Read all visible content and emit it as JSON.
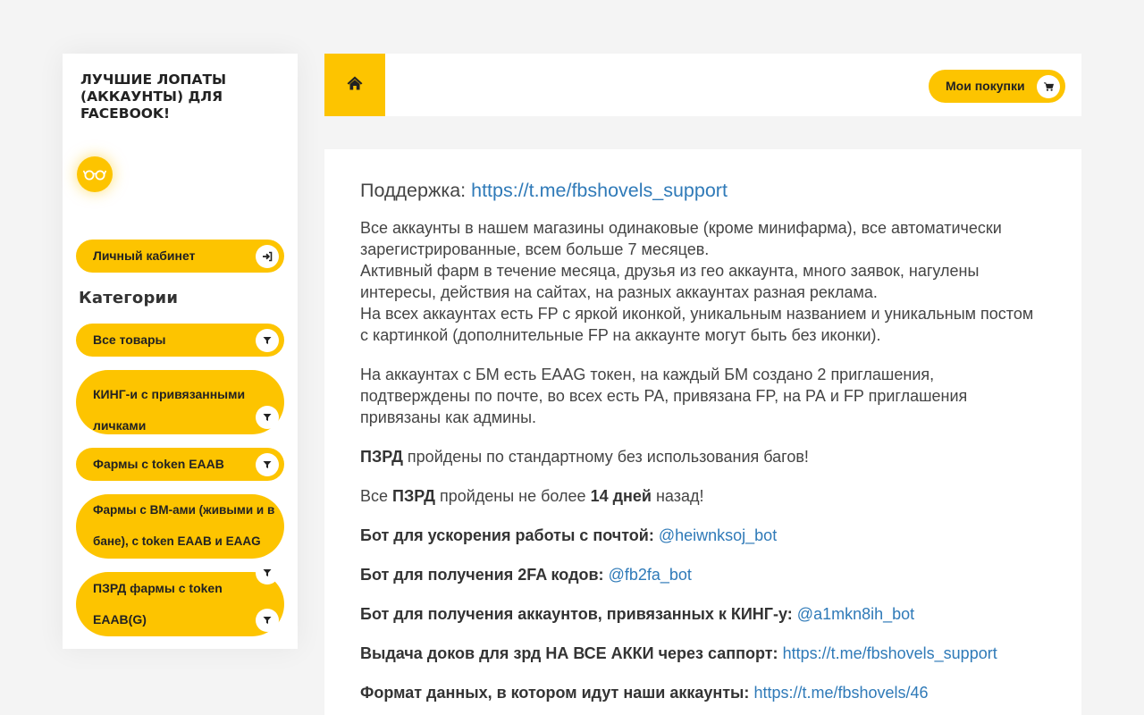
{
  "brand": {
    "line1": "ЛУЧШИЕ ЛОПАТЫ",
    "line2": "(АККАУНТЫ) ДЛЯ",
    "line3": "FACEBOOK!",
    "avatar_icon": "glasses-icon"
  },
  "sidebar": {
    "account_button": {
      "label": "Личный кабинет",
      "icon": "sign-in-icon"
    },
    "categories_title": "Категории",
    "categories": [
      {
        "label": "Все товары",
        "icon": "filter-icon"
      },
      {
        "label_line1": "КИНГ-и с привязанными",
        "label_line2": "личками",
        "icon": "filter-icon"
      },
      {
        "label": "Фармы с token EAAB",
        "icon": "filter-icon"
      },
      {
        "label_line1": "Фармы с BM-ами (живыми и в",
        "label_line2": "бане), с token EAAB и EAAG",
        "icon": "filter-icon"
      },
      {
        "label_line1": "ПЗРД фармы с token",
        "label_line2": "EAAB(G)",
        "icon": "filter-icon"
      }
    ]
  },
  "topbar": {
    "home_icon": "home-icon",
    "purchases_label": "Мои покупки",
    "purchases_icon": "cart-icon"
  },
  "content": {
    "support_label": "Поддержка:",
    "support_link": "https://t.me/fbshovels_support",
    "para1": [
      "Все аккаунты в нашем магазины одинаковые (кроме минифарма), все автоматически зарегистрированные, всем больше 7 месяцев.",
      "Активный фарм в течение месяца, друзья из гео аккаунта, много заявок, нагулены интересы, действия на сайтах, на разных аккаунтах разная реклама.",
      "На всех аккаунтах есть FP с яркой иконкой, уникальным названием и уникальным постом с картинкой (дополнительные FP на аккаунте могут быть без иконки)."
    ],
    "para2": "На аккаунтах с БМ есть EAAG токен, на каждый БМ создано 2 приглашения, подтверждены по почте, во всех есть РА, привязана FP, на РА и FP приглашения привязаны как админы.",
    "para3_bold": "ПЗРД",
    "para3_text": " пройдены по стандартному без использования багов!",
    "para4_a": "Все ",
    "para4_bold1": "ПЗРД",
    "para4_b": " пройдены не более ",
    "para4_bold2": "14 дней",
    "para4_c": " назад!",
    "bots": [
      {
        "label": "Бот для ускорения работы с почтой:",
        "link": "@heiwnksoj_bot"
      },
      {
        "label": "Бот для получения 2FA кодов:",
        "link": "@fb2fa_bot"
      },
      {
        "label": "Бот для получения аккаунтов, привязанных к КИНГ-у:",
        "link": "@a1mkn8ih_bot"
      },
      {
        "label": "Выдача доков для зрд НА ВСЕ АККИ через саппорт:",
        "link": "https://t.me/fbshovels_support"
      },
      {
        "label": "Формат данных, в котором идут наши аккаунты:",
        "link": "https://t.me/fbshovels/46"
      }
    ]
  },
  "colors": {
    "accent": "#fdc400",
    "link": "#2f7ab8",
    "text": "#444444",
    "background": "#f4f4f4"
  }
}
